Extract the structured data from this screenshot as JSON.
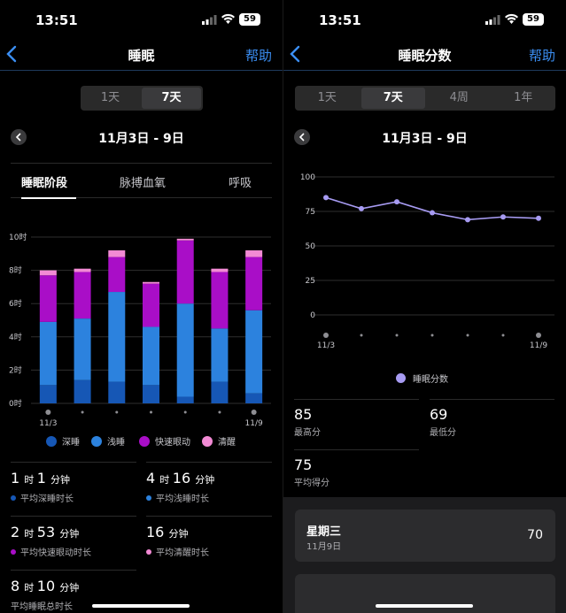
{
  "status": {
    "time": "13:51",
    "battery": "59"
  },
  "left": {
    "title": "睡眠",
    "help": "帮助",
    "segments": [
      "1天",
      "7天"
    ],
    "selected_segment": "7天",
    "date_range": "11月3日 - 9日",
    "tabs": [
      "睡眠阶段",
      "脉搏血氧",
      "呼吸"
    ],
    "selected_tab": "睡眠阶段",
    "legend": [
      {
        "label": "深睡",
        "color": "#1657b5"
      },
      {
        "label": "浅睡",
        "color": "#2c82de"
      },
      {
        "label": "快速眼动",
        "color": "#a90ec7"
      },
      {
        "label": "清醒",
        "color": "#f28ad4"
      }
    ],
    "stats": [
      {
        "n1": "1",
        "u1": "时",
        "n2": "1",
        "u2": "分钟",
        "label": "平均深睡时长",
        "color": "#1657b5"
      },
      {
        "n1": "4",
        "u1": "时",
        "n2": "16",
        "u2": "分钟",
        "label": "平均浅睡时长",
        "color": "#2c82de"
      },
      {
        "n1": "2",
        "u1": "时",
        "n2": "53",
        "u2": "分钟",
        "label": "平均快速眼动时长",
        "color": "#a90ec7"
      },
      {
        "n1": "",
        "u1": "",
        "n2": "16",
        "u2": "分钟",
        "label": "平均清醒时长",
        "color": "#f28ad4"
      },
      {
        "n1": "8",
        "u1": "时",
        "n2": "10",
        "u2": "分钟",
        "label": "平均睡眠总时长",
        "color": ""
      }
    ]
  },
  "right": {
    "title": "睡眠分数",
    "help": "帮助",
    "segments": [
      "1天",
      "7天",
      "4周",
      "1年"
    ],
    "selected_segment": "7天",
    "date_range": "11月3日 - 9日",
    "legend_label": "睡眠分数",
    "stats": [
      {
        "value": "85",
        "label": "最高分"
      },
      {
        "value": "69",
        "label": "最低分"
      },
      {
        "value": "75",
        "label": "平均得分"
      }
    ],
    "card": {
      "day": "星期三",
      "date": "11月9日",
      "score": "70"
    }
  },
  "chart_data": [
    {
      "type": "bar",
      "stacked": true,
      "categories": [
        "11/3",
        "",
        "",
        "",
        "",
        "",
        "11/9"
      ],
      "y_ticks": [
        "0时",
        "2时",
        "4时",
        "6时",
        "8时",
        "10时"
      ],
      "ylim": [
        0,
        10
      ],
      "series": [
        {
          "name": "深睡",
          "color": "#1657b5",
          "values": [
            1.1,
            1.4,
            1.3,
            1.1,
            0.4,
            1.3,
            0.6
          ]
        },
        {
          "name": "浅睡",
          "color": "#2c82de",
          "values": [
            3.8,
            3.7,
            5.4,
            3.5,
            5.6,
            3.2,
            5.0
          ]
        },
        {
          "name": "快速眼动",
          "color": "#a90ec7",
          "values": [
            2.8,
            2.8,
            2.1,
            2.6,
            3.8,
            3.4,
            3.2
          ]
        },
        {
          "name": "清醒",
          "color": "#f28ad4",
          "values": [
            0.3,
            0.2,
            0.4,
            0.1,
            0.1,
            0.2,
            0.4
          ]
        }
      ]
    },
    {
      "type": "line",
      "categories": [
        "11/3",
        "",
        "",
        "",
        "",
        "",
        "11/9"
      ],
      "y_ticks": [
        "0",
        "25",
        "50",
        "75",
        "100"
      ],
      "ylim": [
        0,
        100
      ],
      "series": [
        {
          "name": "睡眠分数",
          "color": "#a79bf2",
          "values": [
            85,
            77,
            82,
            74,
            69,
            71,
            70
          ]
        }
      ]
    }
  ]
}
